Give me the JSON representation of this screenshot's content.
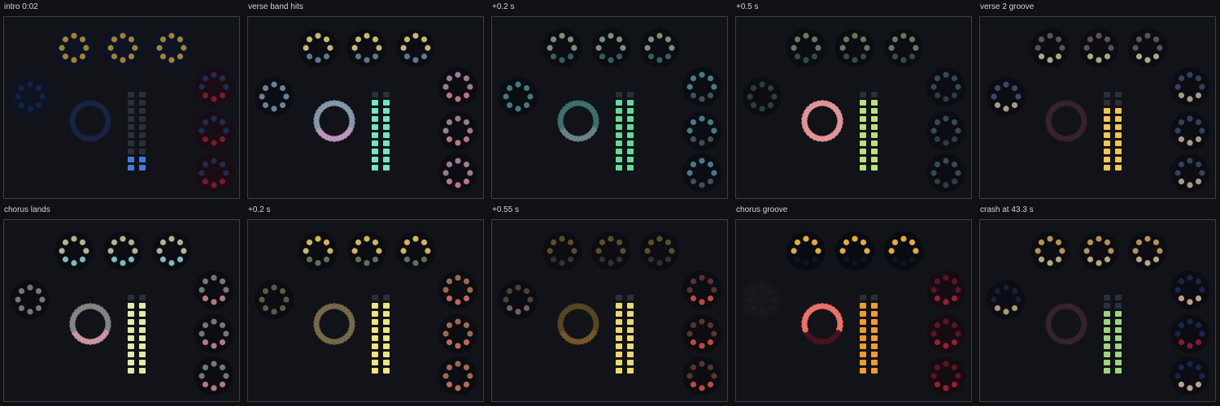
{
  "panels": [
    {
      "label": "intro 0:02",
      "top_dots": "#d4a537",
      "top_bright": 0.75,
      "top_back": "#0c1424",
      "left_dots": "#1b2f5e",
      "left_bright": 0.55,
      "left_back": "#0c1424",
      "right_top": "#20325f",
      "right_bottom": "#8b1c35",
      "right_bright": 0.85,
      "right_back": "#1a0c14",
      "ring_color": "#1b2b52",
      "ring_accent": "#1b2b52",
      "ring_bright": 0.6,
      "meter_color": "#3d7be5",
      "meter_level": 0.15
    },
    {
      "label": "verse band hits",
      "top_dots": "#e6d48a",
      "top_bottom": "#6d8aa0",
      "top_bright": 0.85,
      "top_back": "#0b0d12",
      "left_dots": "#7a95b4",
      "left_bright": 0.85,
      "left_back": "#0b0d12",
      "right_top": "#b58fa6",
      "right_bottom": "#d98a94",
      "right_bright": 0.85,
      "right_back": "#0b0d12",
      "ring_color": "#8a9fb0",
      "ring_accent": "#c69bc4",
      "ring_bright": 0.9,
      "meter_color": "#6ee7c5",
      "meter_level": 0.9
    },
    {
      "label": "+0.2 s",
      "top_dots": "#8ba88a",
      "top_bottom": "#3f6a6e",
      "top_bright": 0.85,
      "top_back": "#0b0d12",
      "left_dots": "#4a8c98",
      "left_bright": 0.85,
      "left_back": "#0b0d12",
      "right_top": "#4e8fa0",
      "right_bottom": "#4a5c62",
      "right_bright": 0.85,
      "right_back": "#0b0d12",
      "ring_color": "#3f7470",
      "ring_accent": "#6e8a8a",
      "ring_bright": 0.9,
      "meter_color": "#5fdc93",
      "meter_level": 0.9
    },
    {
      "label": "+0.5 s",
      "top_dots": "#7d8a6e",
      "top_bottom": "#3a5a4a",
      "top_bright": 0.85,
      "top_back": "#0b0d12",
      "left_dots": "#2f4a4a",
      "left_bright": 0.85,
      "left_back": "#0b0d12",
      "right_top": "#3a5660",
      "right_bottom": "#33474a",
      "right_bright": 0.85,
      "right_back": "#0b0d12",
      "ring_color": "#e8979b",
      "ring_accent": "#e8979b",
      "ring_bright": 0.95,
      "meter_color": "#b8e27a",
      "meter_level": 0.9
    },
    {
      "label": "verse 2 groove",
      "top_dots": "#6e5a6a",
      "top_bottom": "#c9c29a",
      "top_bright": 0.85,
      "top_back": "#0b0d12",
      "left_dots": "#46527a",
      "left_bottom": "#c8b39a",
      "left_bright": 0.85,
      "left_back": "#0b0d12",
      "right_top": "#3a4a6e",
      "right_bottom": "#c8b09a",
      "right_bright": 0.85,
      "right_back": "#0b0d12",
      "ring_color": "#3a2230",
      "ring_accent": "#3a2230",
      "ring_bright": 0.9,
      "meter_color": "#f6c453",
      "meter_level": 0.8
    },
    {
      "label": "chorus lands",
      "top_dots": "#c8c2a0",
      "top_bottom": "#8ec9d4",
      "top_bright": 0.9,
      "top_back": "#0b0d12",
      "left_dots": "#8a8a86",
      "left_bright": 0.85,
      "left_back": "#0b0d12",
      "right_top": "#8a8a86",
      "right_bottom": "#d88a90",
      "right_bright": 0.85,
      "right_back": "#0b0d12",
      "ring_color": "#8c8a88",
      "ring_accent": "#d89aa8",
      "ring_bright": 0.9,
      "meter_color": "#e4eaa8",
      "meter_level": 0.9
    },
    {
      "label": "+0.2 s",
      "top_dots": "#e5c960",
      "top_bottom": "#6c7a60",
      "top_bright": 0.9,
      "top_back": "#0b0d12",
      "left_dots": "#6a6a50",
      "left_bright": 0.85,
      "left_back": "#0b0d12",
      "right_top": "#b87a5a",
      "right_bottom": "#df7866",
      "right_bright": 0.85,
      "right_back": "#0b0d12",
      "ring_color": "#7a6e4a",
      "ring_accent": "#7a6e4a",
      "ring_bright": 0.9,
      "meter_color": "#f2e37a",
      "meter_level": 0.9
    },
    {
      "label": "+0.55 s",
      "top_dots": "#6a5a2a",
      "top_bottom": "#3a3a2a",
      "top_bright": 0.85,
      "top_back": "#0b0d12",
      "left_dots": "#5a4a3a",
      "left_bottom": "#8a6a7a",
      "left_bright": 0.85,
      "left_back": "#0b0d12",
      "right_top": "#6a3a34",
      "right_bottom": "#e0524a",
      "right_bright": 0.85,
      "right_back": "#0b0d12",
      "ring_color": "#5a4a22",
      "ring_accent": "#7a5a2a",
      "ring_bright": 0.9,
      "meter_color": "#f2d76a",
      "meter_level": 0.9
    },
    {
      "label": "chorus groove",
      "top_dots": "#f2b43a",
      "top_bottom": "#101624",
      "top_bright": 0.95,
      "top_back": "#090b12",
      "left_dots": "#1a1c24",
      "left_bright": 0.8,
      "left_back": "#15171d",
      "right_top": "#6a1628",
      "right_bottom": "#b0213a",
      "right_bright": 0.85,
      "right_back": "#150c12",
      "ring_color": "#f2736a",
      "ring_accent": "#4a1220",
      "ring_bright": 0.95,
      "meter_color": "#f59a2e",
      "meter_level": 0.9
    },
    {
      "label": "crash at 43.3 s",
      "top_dots": "#c8a060",
      "top_bottom": "#c8b890",
      "top_bright": 0.9,
      "top_back": "#0b0d12",
      "left_dots": "#1a2440",
      "left_bottom": "#c8b08a",
      "left_bright": 0.85,
      "left_back": "#0b0d12",
      "right_top": "#1a2a5a",
      "right_bottom": "#e0b89a",
      "right_mid": "#a01c32",
      "right_bright": 0.85,
      "right_back": "#0b0d12",
      "ring_color": "#3a2230",
      "ring_accent": "#3a2230",
      "ring_bright": 0.9,
      "meter_color": "#9bd67a",
      "meter_level": 0.8
    }
  ]
}
